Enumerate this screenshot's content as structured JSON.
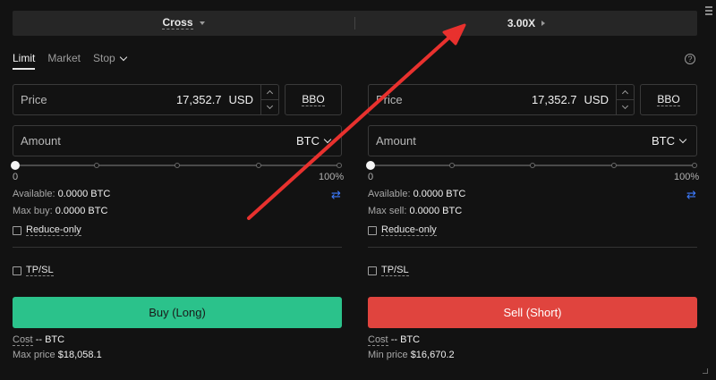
{
  "margin": {
    "mode_label": "Cross",
    "leverage_label": "3.00X"
  },
  "tabs": {
    "limit": "Limit",
    "market": "Market",
    "stop": "Stop"
  },
  "help_glyph": "?",
  "buy_panel": {
    "price_placeholder": "Price",
    "price_value": "17,352.7",
    "price_unit": "USD",
    "bbo_label": "BBO",
    "amount_placeholder": "Amount",
    "amount_unit": "BTC",
    "slider_min": "0",
    "slider_max": "100%",
    "slider_percent": 0,
    "available_label": "Available:",
    "available_value": "0.0000 BTC",
    "max_label": "Max buy:",
    "max_value": "0.0000 BTC",
    "reduce_only": "Reduce-only",
    "tpsl": "TP/SL",
    "action_label": "Buy (Long)",
    "cost_label": "Cost",
    "cost_value": "-- BTC",
    "limit_price_label": "Max price",
    "limit_price_value": "$18,058.1"
  },
  "sell_panel": {
    "price_placeholder": "Price",
    "price_value": "17,352.7",
    "price_unit": "USD",
    "bbo_label": "BBO",
    "amount_placeholder": "Amount",
    "amount_unit": "BTC",
    "slider_min": "0",
    "slider_max": "100%",
    "slider_percent": 0,
    "available_label": "Available:",
    "available_value": "0.0000 BTC",
    "max_label": "Max sell:",
    "max_value": "0.0000 BTC",
    "reduce_only": "Reduce-only",
    "tpsl": "TP/SL",
    "action_label": "Sell (Short)",
    "cost_label": "Cost",
    "cost_value": "-- BTC",
    "limit_price_label": "Min price",
    "limit_price_value": "$16,670.2"
  },
  "colors": {
    "buy": "#2bc28b",
    "sell": "#e0443e",
    "swap_icon": "#3d7bff",
    "annotation_arrow": "#e8312e"
  },
  "icons": {
    "swap": "swap-icon",
    "help": "help-icon",
    "annotation": "red-arrow-icon"
  }
}
